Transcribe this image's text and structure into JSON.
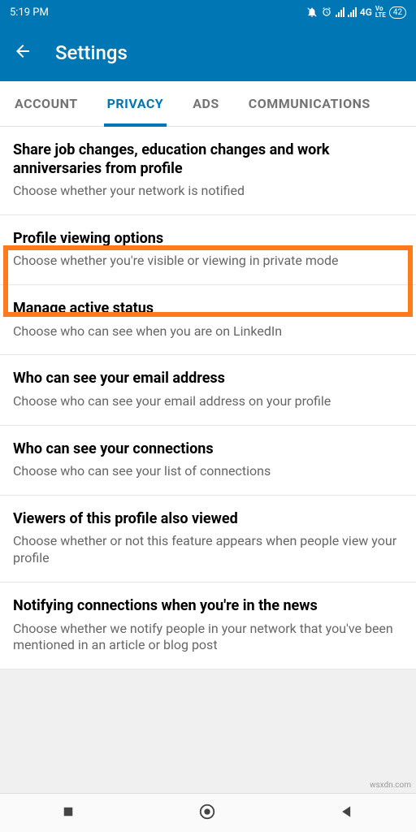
{
  "status": {
    "time": "5:19 PM",
    "network": "4G",
    "volte": "VoLTE",
    "battery": "42"
  },
  "header": {
    "title": "Settings"
  },
  "tabs": [
    {
      "label": "ACCOUNT",
      "active": false
    },
    {
      "label": "PRIVACY",
      "active": true
    },
    {
      "label": "ADS",
      "active": false
    },
    {
      "label": "COMMUNICATIONS",
      "active": false
    }
  ],
  "settings": [
    {
      "title": "Share job changes, education changes and work anniversaries from profile",
      "description": "Choose whether your network is notified",
      "highlighted": false
    },
    {
      "title": "Profile viewing options",
      "description": "Choose whether you're visible or viewing in private mode",
      "highlighted": true
    },
    {
      "title": "Manage active status",
      "description": "Choose who can see when you are on LinkedIn",
      "highlighted": false
    },
    {
      "title": "Who can see your email address",
      "description": "Choose who can see your email address on your profile",
      "highlighted": false
    },
    {
      "title": "Who can see your connections",
      "description": "Choose who can see your list of connections",
      "highlighted": false
    },
    {
      "title": "Viewers of this profile also viewed",
      "description": "Choose whether or not this feature appears when people view your profile",
      "highlighted": false
    },
    {
      "title": "Notifying connections when you're in the news",
      "description": "Choose whether we notify people in your network that you've been mentioned in an article or blog post",
      "highlighted": false
    }
  ],
  "watermark": "wsxdn.com"
}
